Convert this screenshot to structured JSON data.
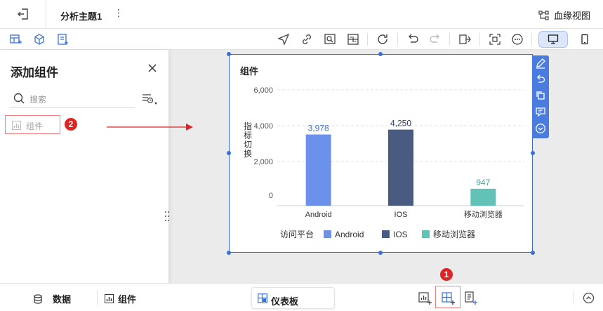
{
  "topbar": {
    "title": "分析主题1",
    "more_label": "⋮",
    "lineage_label": "血缘视图"
  },
  "panel": {
    "title": "添加组件",
    "search_placeholder": "搜索",
    "component_label": "组件",
    "badge_2": "2"
  },
  "chart_card": {
    "title": "组件"
  },
  "chart_data": {
    "type": "bar",
    "title": "组件",
    "categories": [
      "Android",
      "IOS",
      "移动浏览器"
    ],
    "values": [
      3978,
      4250,
      947
    ],
    "value_labels": [
      "3,978",
      "4,250",
      "947"
    ],
    "colors": [
      "#6b91eb",
      "#4a5b82",
      "#63c2b8"
    ],
    "ylabel": "指标切换",
    "yticks": [
      "0",
      "2,000",
      "4,000",
      "6,000"
    ],
    "ylim": [
      0,
      6000
    ],
    "grid": true,
    "legend": {
      "title": "访问平台",
      "position": "bottom",
      "entries": [
        "Android",
        "IOS",
        "移动浏览器"
      ]
    }
  },
  "bottombar": {
    "data_label": "数据",
    "component_label": "组件",
    "dashboard_label": "仪表板",
    "badge_1": "1"
  }
}
